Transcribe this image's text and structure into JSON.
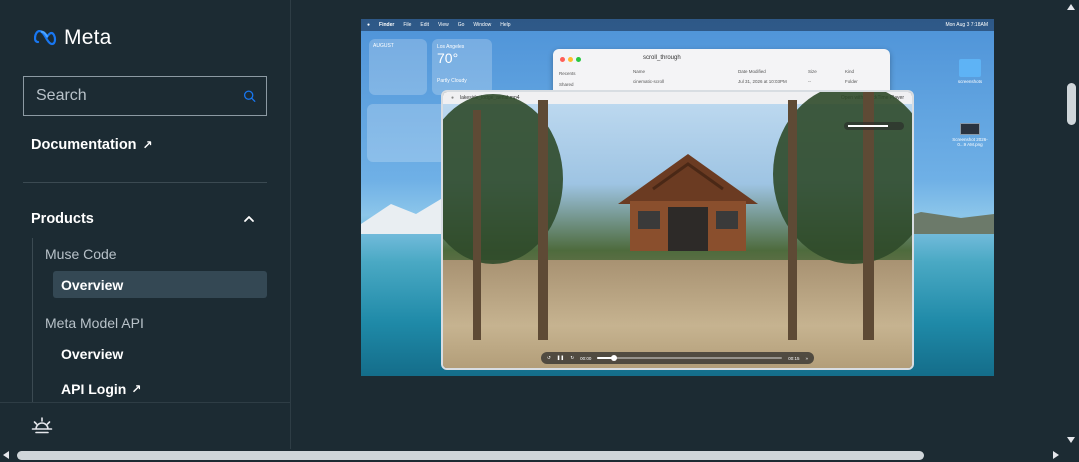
{
  "brand": {
    "name": "Meta"
  },
  "search": {
    "placeholder": "Search"
  },
  "nav": {
    "documentation_label": "Documentation",
    "products_label": "Products",
    "groups": [
      {
        "label": "Muse Code",
        "items": [
          {
            "label": "Overview",
            "active": true
          }
        ]
      },
      {
        "label": "Meta Model API",
        "items": [
          {
            "label": "Overview",
            "active": false
          },
          {
            "label": "API Login",
            "external": true
          }
        ]
      }
    ]
  },
  "arrow_glyph": "↗",
  "screenshot": {
    "menubar": {
      "app": "Finder",
      "menus": [
        "File",
        "Edit",
        "View",
        "Go",
        "Window",
        "Help"
      ],
      "clock": "Mon Aug 3 7:18AM"
    },
    "weather": {
      "city": "Los Angeles",
      "temp": "70°",
      "condition": "Partly Cloudy"
    },
    "calendar": {
      "month": "AUGUST"
    },
    "finder": {
      "title": "scroll_through",
      "sidebar_recents": "Recents",
      "sidebar_shared": "Shared",
      "col_name": "Name",
      "col_date": "Date Modified",
      "col_size": "Size",
      "col_kind": "Kind",
      "row_name": "cinematic-scroll",
      "row_date": "Jul 31, 2026 at 10:03PM",
      "row_size": "--",
      "row_kind": "Folder"
    },
    "player": {
      "filename": "lakeside_lodge_aerial.mp4",
      "open_with": "Open with QuickTime Player",
      "time_current": "00:00",
      "time_total": "00:15",
      "progress": 0.09
    },
    "desktop": {
      "folder_label": "screenshots",
      "file_label": "Screenshot 2026-0...9 AM.png"
    }
  },
  "colors": {
    "bg": "#1c2b33",
    "active_item": "#344854",
    "accent": "#0866ff"
  }
}
